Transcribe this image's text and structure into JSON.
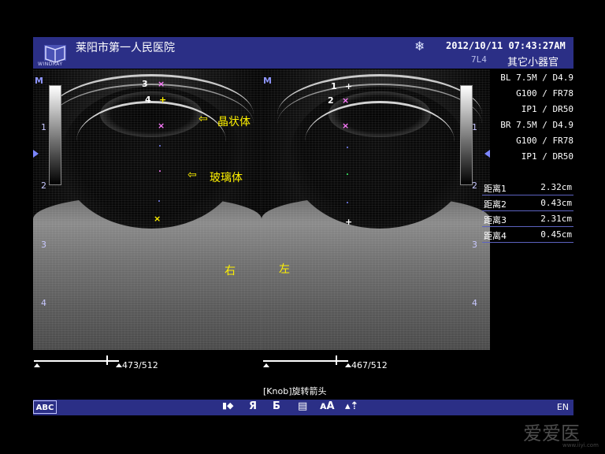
{
  "header": {
    "logo_text": "WINDRAY",
    "hospital": "莱阳市第一人民医院",
    "datetime": "2012/10/11  07:43:27AM",
    "probe": "7L4",
    "preset": "其它小器官"
  },
  "depth_marks": [
    "1",
    "2",
    "3",
    "4"
  ],
  "image_left": {
    "marker_labels": [
      "3",
      "4"
    ],
    "annotation_lens": "晶状体",
    "annotation_vitreous": "玻璃体",
    "side_label": "右",
    "cine": "473/512"
  },
  "image_right": {
    "marker_labels": [
      "1",
      "2"
    ],
    "side_label": "左",
    "cine": "467/512"
  },
  "params": {
    "bl_1": "BL 7.5M / D4.9",
    "bl_2": "G100 / FR78",
    "bl_3": "IP1 / DR50",
    "br_1": "BR 7.5M / D4.9",
    "br_2": "G100 / FR78",
    "br_3": "IP1 / DR50"
  },
  "measurements": [
    {
      "label": "距离1",
      "value": "2.32cm"
    },
    {
      "label": "距离2",
      "value": "0.43cm"
    },
    {
      "label": "距离3",
      "value": "2.31cm"
    },
    {
      "label": "距离4",
      "value": "0.45cm"
    }
  ],
  "hint": "[Knob]旋转箭头",
  "footer": {
    "abc": "ABC",
    "lang": "EN"
  },
  "colors": {
    "panel": "#2b2f86",
    "annotation": "#fff200",
    "marker": "#ff7bff"
  },
  "watermark": "爱爱医",
  "watermark_url": "www.iiyi.com"
}
